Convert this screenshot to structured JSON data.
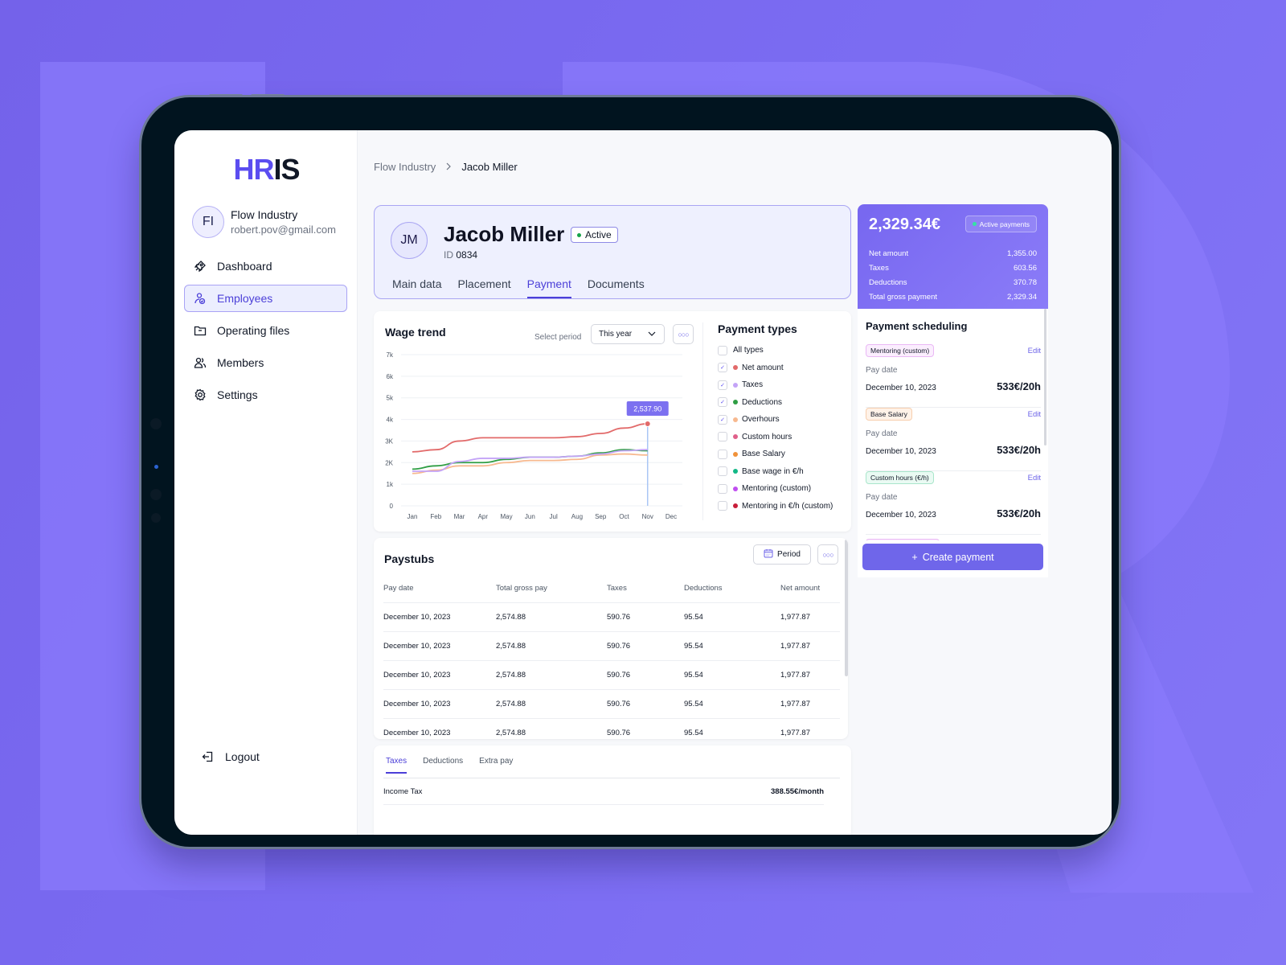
{
  "brand": {
    "logo_left": "H",
    "logo_mid": "R",
    "logo_right": "IS",
    "accent": "#5b4df0"
  },
  "org": {
    "initials": "FI",
    "name": "Flow Industry",
    "email": "robert.pov@gmail.com"
  },
  "sidebar": {
    "items": [
      {
        "label": "Dashboard",
        "icon": "rocket-icon",
        "active": false
      },
      {
        "label": "Employees",
        "icon": "employees-icon",
        "active": true
      },
      {
        "label": "Operating files",
        "icon": "folder-icon",
        "active": false
      },
      {
        "label": "Members",
        "icon": "members-icon",
        "active": false
      },
      {
        "label": "Settings",
        "icon": "gear-icon",
        "active": false
      }
    ],
    "logout": "Logout"
  },
  "breadcrumb": {
    "parent": "Flow Industry",
    "current": "Jacob Miller"
  },
  "profile": {
    "initials": "JM",
    "name": "Jacob Miller",
    "status": "Active",
    "status_color": "#16a34a",
    "id_label": "ID",
    "id_value": "0834",
    "tabs": [
      "Main data",
      "Placement",
      "Payment",
      "Documents"
    ],
    "active_tab": "Payment"
  },
  "wage_trend": {
    "title": "Wage trend",
    "select_label": "Select period",
    "select_value": "This year",
    "tooltip": "2,537.90"
  },
  "payment_types": {
    "title": "Payment types",
    "items": [
      {
        "label": "All types",
        "checked": false,
        "color": null
      },
      {
        "label": "Net amount",
        "checked": true,
        "color": "#e26a6a"
      },
      {
        "label": "Taxes",
        "checked": true,
        "color": "#c4a4f7"
      },
      {
        "label": "Deductions",
        "checked": true,
        "color": "#2f9e44"
      },
      {
        "label": "Overhours",
        "checked": true,
        "color": "#f7b98f"
      },
      {
        "label": "Custom hours",
        "checked": false,
        "color": "#e0608a"
      },
      {
        "label": "Base Salary",
        "checked": false,
        "color": "#f0923a"
      },
      {
        "label": "Base wage in €/h",
        "checked": false,
        "color": "#12b886"
      },
      {
        "label": "Mentoring (custom)",
        "checked": false,
        "color": "#c04ef0"
      },
      {
        "label": "Mentoring in €/h (custom)",
        "checked": false,
        "color": "#c81e3a"
      }
    ]
  },
  "chart_data": {
    "type": "line",
    "title": "Wage trend",
    "xlabel": "",
    "ylabel": "",
    "categories": [
      "Jan",
      "Feb",
      "Mar",
      "Apr",
      "May",
      "Jun",
      "Jul",
      "Aug",
      "Sep",
      "Oct",
      "Nov",
      "Dec"
    ],
    "y_ticks": [
      "0",
      "1k",
      "2K",
      "3K",
      "4k",
      "5k",
      "6k",
      "7k"
    ],
    "ylim": [
      0,
      7000
    ],
    "grid": true,
    "series": [
      {
        "name": "Net amount",
        "color": "#e26a6a",
        "values": [
          2500,
          2600,
          3000,
          3150,
          3150,
          3150,
          3150,
          3200,
          3350,
          3600,
          3800
        ]
      },
      {
        "name": "Taxes",
        "color": "#c4a4f7",
        "values": [
          1600,
          1600,
          2050,
          2200,
          2200,
          2250,
          2250,
          2300,
          2400,
          2550,
          2600
        ]
      },
      {
        "name": "Deductions",
        "color": "#2f9e44",
        "values": [
          1700,
          1850,
          2000,
          2000,
          2150,
          2250,
          2250,
          2300,
          2450,
          2600,
          2550
        ]
      },
      {
        "name": "Overhours",
        "color": "#f7b98f",
        "values": [
          1500,
          1650,
          1850,
          1850,
          2000,
          2100,
          2100,
          2150,
          2350,
          2400,
          2350
        ]
      }
    ],
    "highlight": {
      "category": "Nov",
      "series": "Net amount",
      "label": "2,537.90"
    }
  },
  "paystubs": {
    "title": "Paystubs",
    "period_button": "Period",
    "columns": [
      "Pay date",
      "Total gross pay",
      "Taxes",
      "Deductions",
      "Net amount"
    ],
    "rows": [
      [
        "December 10, 2023",
        "2,574.88",
        "590.76",
        "95.54",
        "1,977.87"
      ],
      [
        "December 10, 2023",
        "2,574.88",
        "590.76",
        "95.54",
        "1,977.87"
      ],
      [
        "December 10, 2023",
        "2,574.88",
        "590.76",
        "95.54",
        "1,977.87"
      ],
      [
        "December 10, 2023",
        "2,574.88",
        "590.76",
        "95.54",
        "1,977.87"
      ],
      [
        "December 10, 2023",
        "2,574.88",
        "590.76",
        "95.54",
        "1,977.87"
      ]
    ]
  },
  "deductions": {
    "tabs": [
      "Taxes",
      "Deductions",
      "Extra pay"
    ],
    "active_tab": "Taxes",
    "rows": [
      {
        "label": "Income Tax",
        "value": "388.55€/month"
      }
    ]
  },
  "summary": {
    "total": "2,329.34€",
    "badge": "Active payments",
    "rows": [
      {
        "label": "Net amount",
        "value": "1,355.00"
      },
      {
        "label": "Taxes",
        "value": "603.56"
      },
      {
        "label": "Deductions",
        "value": "370.78"
      },
      {
        "label": "Total gross payment",
        "value": "2,329.34"
      }
    ]
  },
  "scheduling": {
    "title": "Payment scheduling",
    "items": [
      {
        "tag": "Mentoring (custom)",
        "tag_bg": "#fbeefe",
        "tag_border": "#eab8f5",
        "edit": "Edit",
        "pay_date_label": "Pay date",
        "pay_date": "December 10, 2023",
        "rate": "533€/20h"
      },
      {
        "tag": "Base Salary",
        "tag_bg": "#fff2e8",
        "tag_border": "#f7cfae",
        "edit": "Edit",
        "pay_date_label": "Pay date",
        "pay_date": "December 10, 2023",
        "rate": "533€/20h"
      },
      {
        "tag": "Custom hours (€/h)",
        "tag_bg": "#eafaf3",
        "tag_border": "#a9e6cb",
        "edit": "Edit",
        "pay_date_label": "Pay date",
        "pay_date": "December 10, 2023",
        "rate": "533€/20h"
      }
    ],
    "create_button": "Create payment"
  }
}
